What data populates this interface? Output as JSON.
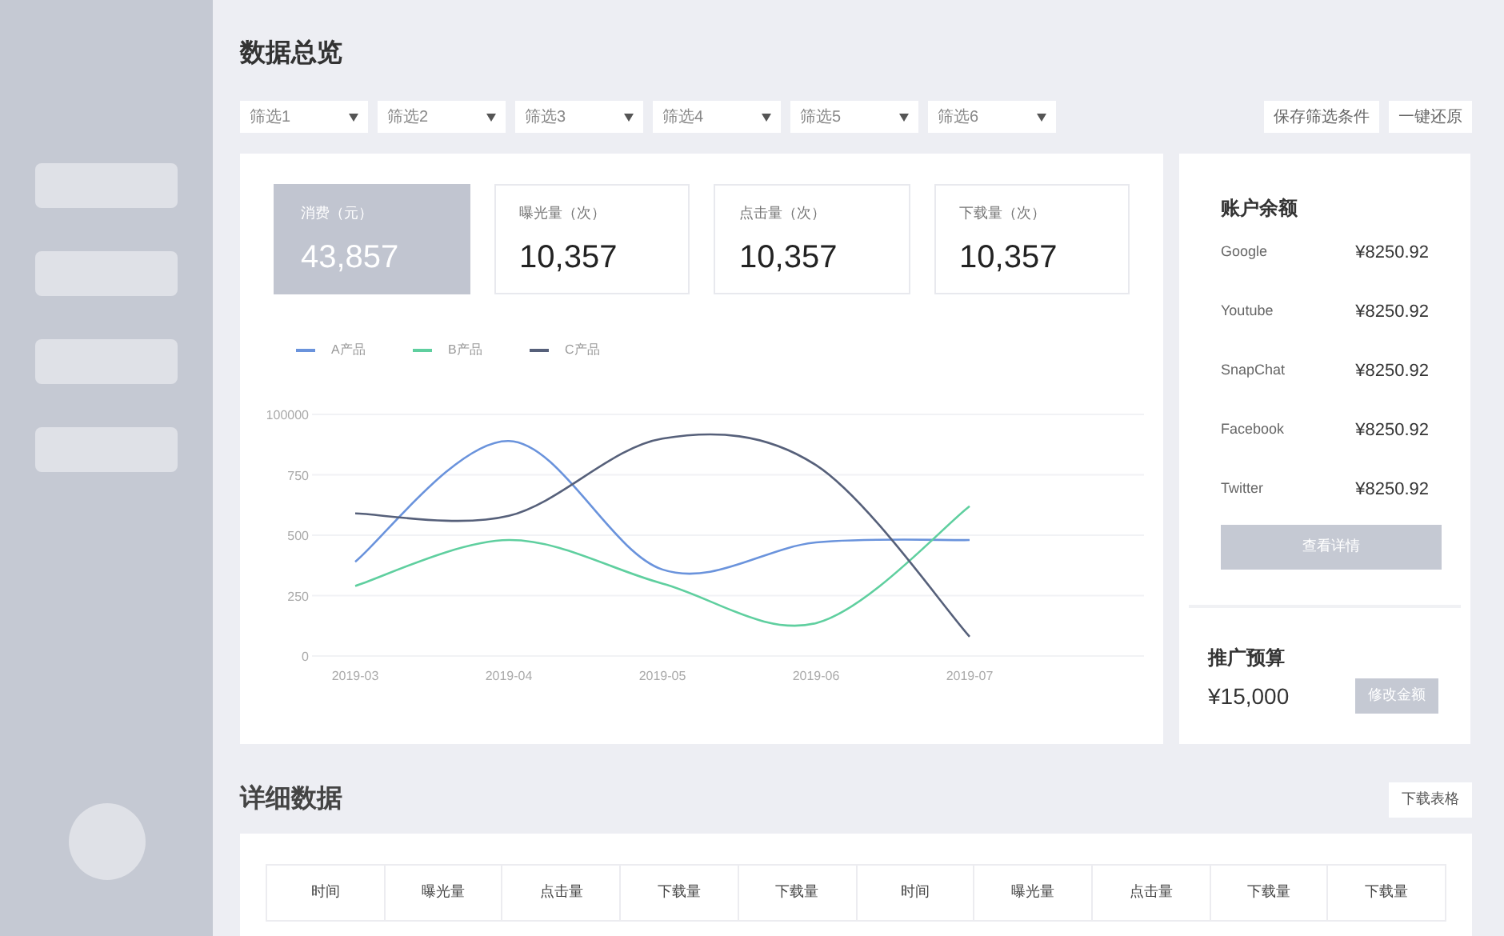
{
  "page_title": "数据总览",
  "filters": [
    {
      "label": "筛选1"
    },
    {
      "label": "筛选2"
    },
    {
      "label": "筛选3"
    },
    {
      "label": "筛选4"
    },
    {
      "label": "筛选5"
    },
    {
      "label": "筛选6"
    }
  ],
  "filter_actions": [
    "保存筛选条件",
    "一键还原"
  ],
  "stats": [
    {
      "label": "消费（元）",
      "value": "43,857",
      "selected": true
    },
    {
      "label": "曝光量（次）",
      "value": "10,357",
      "selected": false
    },
    {
      "label": "点击量（次）",
      "value": "10,357",
      "selected": false
    },
    {
      "label": "下载量（次）",
      "value": "10,357",
      "selected": false
    }
  ],
  "y_axis_labels": [
    "100000",
    "750",
    "500",
    "250",
    "0"
  ],
  "chart_data": {
    "type": "line",
    "grid": true,
    "categories": [
      "2019-03",
      "2019-04",
      "2019-05",
      "2019-06",
      "2019-07"
    ],
    "ylim": [
      0,
      1000
    ],
    "yticks": [
      0,
      250,
      500,
      750
    ],
    "series": [
      {
        "name": "A产品",
        "color": "#6a93dc",
        "values": [
          390,
          890,
          358,
          470,
          480
        ]
      },
      {
        "name": "B产品",
        "color": "#5fcf9f",
        "values": [
          290,
          480,
          300,
          136,
          620
        ]
      },
      {
        "name": "C产品",
        "color": "#56607a",
        "values": [
          590,
          580,
          900,
          790,
          80
        ]
      }
    ]
  },
  "balance": {
    "title": "账户余额",
    "rows": [
      {
        "name": "Google",
        "amount": "¥8250.92"
      },
      {
        "name": "Youtube",
        "amount": "¥8250.92"
      },
      {
        "name": "SnapChat",
        "amount": "¥8250.92"
      },
      {
        "name": "Facebook",
        "amount": "¥8250.92"
      },
      {
        "name": "Twitter",
        "amount": "¥8250.92"
      }
    ],
    "button": "查看详情"
  },
  "budget": {
    "title": "推广预算",
    "amount": "¥15,000",
    "button": "修改金额"
  },
  "detail": {
    "title": "详细数据",
    "button": "下载表格",
    "columns": [
      "时间",
      "曝光量",
      "点击量",
      "下载量",
      "下载量",
      "时间",
      "曝光量",
      "点击量",
      "下载量",
      "下载量"
    ]
  }
}
